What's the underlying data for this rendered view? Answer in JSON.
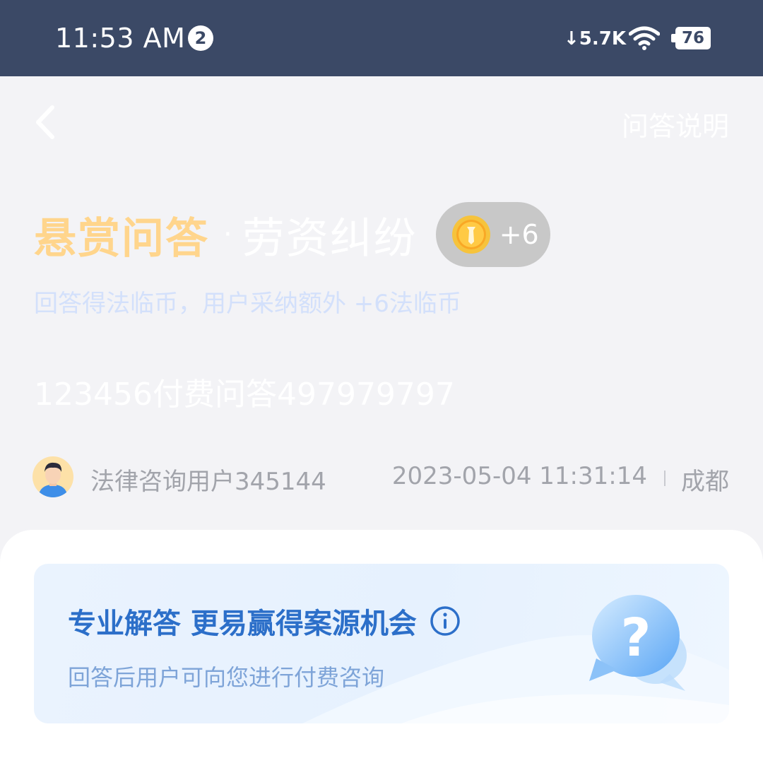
{
  "status_bar": {
    "time": "11:53 AM",
    "notification_count": "2",
    "net_speed": "5.7K",
    "battery": "76"
  },
  "nav": {
    "back_icon": "back-chevron-icon",
    "help_label": "问答说明"
  },
  "header": {
    "reward_label": "悬赏问答",
    "separator": "·",
    "category": "劳资纠纷",
    "reward_value": "+6",
    "coin_icon": "gold-coin-icon",
    "subtitle": "回答得法临币，用户采纳额外 +6法临币"
  },
  "question": {
    "text": "123456付费问答497979797"
  },
  "asker": {
    "name": "法律咨询用户345144",
    "datetime": "2023-05-04 11:31:14",
    "location": "成都"
  },
  "promo": {
    "title": "专业解答 更易赢得案源机会",
    "subtitle": "回答后用户可向您进行付费咨询",
    "info_icon": "info-icon",
    "illustration_icon": "question-bubble-icon"
  },
  "colors": {
    "status_bar_bg": "#3b4966",
    "reward_title": "#ffd58c",
    "promo_title": "#2c6fc9",
    "meta_text": "#a2a4ab"
  }
}
